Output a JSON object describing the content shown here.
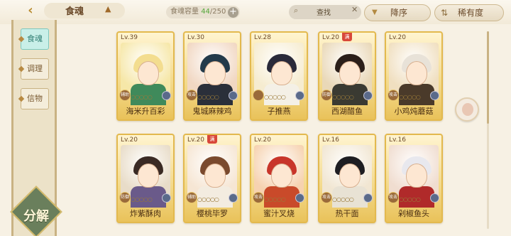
{
  "header": {
    "title": "食魂",
    "capacity_label": "食魂容量",
    "capacity_current": "44",
    "capacity_max": "/250",
    "search_placeholder": "查找",
    "sort_label": "降序",
    "rarity_label": "稀有度"
  },
  "sidebar": {
    "tabs": [
      {
        "label": "食魂"
      },
      {
        "label": "调理"
      },
      {
        "label": "信物"
      }
    ],
    "decompose_label": "分解"
  },
  "cards": [
    {
      "level": "Lv.39",
      "name": "海米升百彩",
      "type": "辅助",
      "tint": "#f6e7a8",
      "hair": "#f3dd8f",
      "cloth": "#3f8a5b"
    },
    {
      "level": "Lv.30",
      "name": "鬼城麻辣鸡",
      "type": "攻击",
      "tint": "#f1d7c2",
      "hair": "#233a4a",
      "cloth": "#2a2f3a"
    },
    {
      "level": "Lv.28",
      "name": "子推燕",
      "type": "",
      "tint": "#f6ecd0",
      "hair": "#2a2a3a",
      "cloth": "#f4f0e6"
    },
    {
      "level": "Lv.20",
      "name": "西湖醋鱼",
      "type": "防御",
      "tint": "#e9d8b8",
      "hair": "#2b1f1a",
      "cloth": "#3a3a32",
      "flag": "满"
    },
    {
      "level": "Lv.20",
      "name": "小鸡炖蘑菇",
      "type": "攻击",
      "tint": "#f0dfc0",
      "hair": "#e8e2d8",
      "cloth": "#4a3a2a"
    },
    {
      "level": "Lv.20",
      "name": "炸紫酥肉",
      "type": "防御",
      "tint": "#e8dcc8",
      "hair": "#3a2a24",
      "cloth": "#6a5a8a"
    },
    {
      "level": "Lv.20",
      "name": "樱桃毕罗",
      "type": "辅助",
      "tint": "#f6e6d4",
      "hair": "#7a4a2e",
      "cloth": "#f3ece0",
      "flag": "满"
    },
    {
      "level": "Lv.20",
      "name": "蜜汁叉烧",
      "type": "攻击",
      "tint": "#f6d2b0",
      "hair": "#c8352a",
      "cloth": "#c94a2a"
    },
    {
      "level": "Lv.16",
      "name": "热干面",
      "type": "攻击",
      "tint": "#f1e6d2",
      "hair": "#1e1e22",
      "cloth": "#e8e2d4"
    },
    {
      "level": "Lv.16",
      "name": "剁椒鱼头",
      "type": "攻击",
      "tint": "#f0ddd0",
      "hair": "#e8e8ee",
      "cloth": "#b02a2a"
    }
  ]
}
